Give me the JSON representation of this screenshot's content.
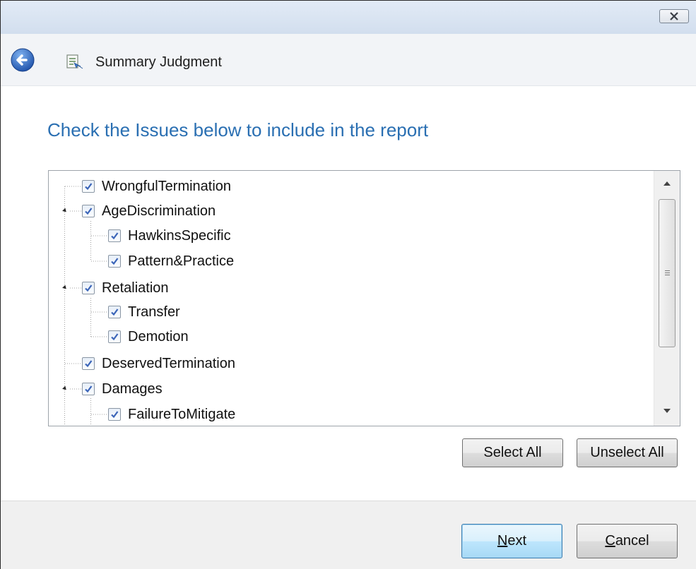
{
  "window": {
    "close_icon": "close-icon"
  },
  "header": {
    "back_icon": "back-arrow-icon",
    "app_icon": "wizard-app-icon",
    "title": "Summary Judgment"
  },
  "instruction": "Check the Issues below to include in the report",
  "tree": {
    "items": [
      {
        "label": "WrongfulTermination",
        "level": 0,
        "checked": true,
        "expandable": false
      },
      {
        "label": "AgeDiscrimination",
        "level": 0,
        "checked": true,
        "expandable": true
      },
      {
        "label": "HawkinsSpecific",
        "level": 1,
        "checked": true,
        "expandable": false
      },
      {
        "label": "Pattern&Practice",
        "level": 1,
        "checked": true,
        "expandable": false
      },
      {
        "label": "Retaliation",
        "level": 0,
        "checked": true,
        "expandable": true
      },
      {
        "label": "Transfer",
        "level": 1,
        "checked": true,
        "expandable": false
      },
      {
        "label": "Demotion",
        "level": 1,
        "checked": true,
        "expandable": false
      },
      {
        "label": "DeservedTermination",
        "level": 0,
        "checked": true,
        "expandable": false
      },
      {
        "label": "Damages",
        "level": 0,
        "checked": true,
        "expandable": true
      },
      {
        "label": "FailureToMitigate",
        "level": 1,
        "checked": true,
        "expandable": false
      }
    ]
  },
  "buttons": {
    "select_all": "Select All",
    "unselect_all": "Unselect All",
    "next_mnemonic": "N",
    "next_rest": "ext",
    "cancel_mnemonic": "C",
    "cancel_rest": "ancel"
  },
  "colors": {
    "accent_heading": "#2a6fb2",
    "check_mark": "#3a64b8",
    "back_button": "#2f68c4"
  }
}
